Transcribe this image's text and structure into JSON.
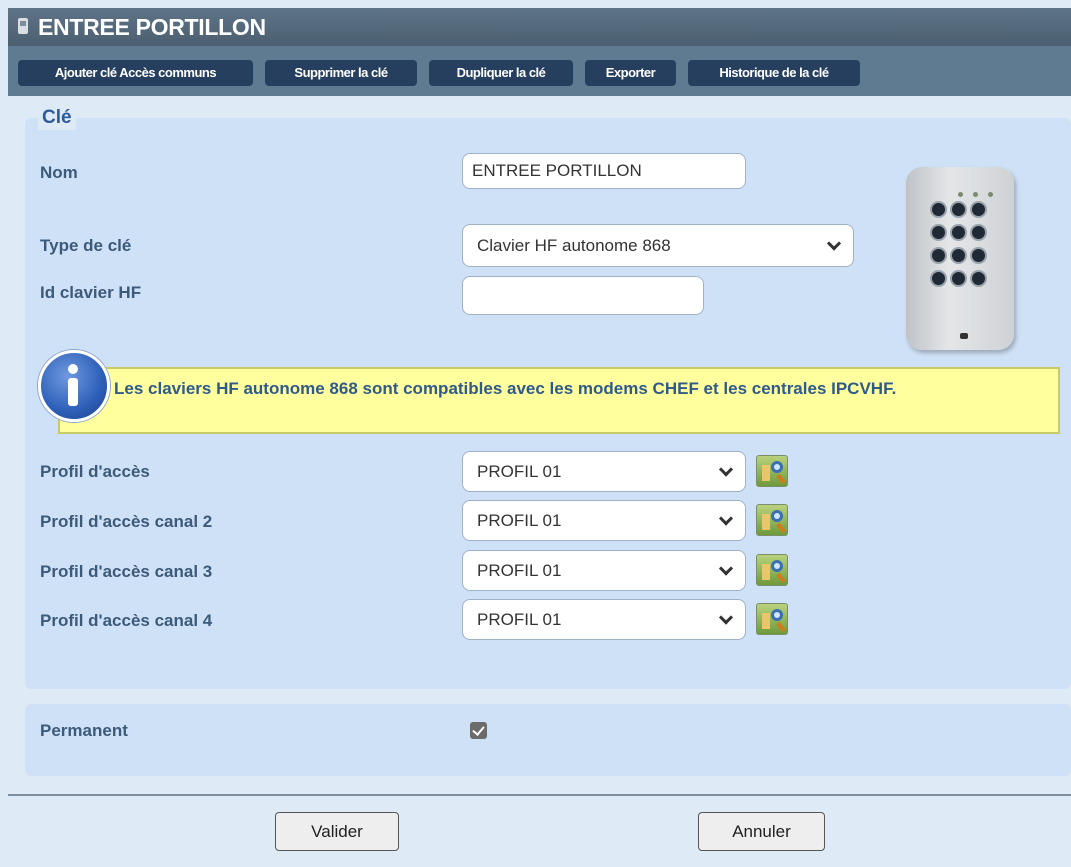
{
  "window": {
    "title": "ENTREE PORTILLON"
  },
  "toolbar": {
    "buttons": [
      "Ajouter clé Accès communs",
      "Supprimer la clé",
      "Dupliquer la clé",
      "Exporter",
      "Historique de la clé"
    ]
  },
  "key_section": {
    "legend": "Clé",
    "nom": {
      "label": "Nom",
      "value": "ENTREE PORTILLON"
    },
    "type": {
      "label": "Type de clé",
      "value": "Clavier HF autonome 868"
    },
    "id_clavier": {
      "label": "Id clavier HF",
      "value": ""
    },
    "info": "Les claviers HF autonome 868 sont compatibles avec les modems CHEF et les centrales IPCVHF.",
    "profiles": [
      {
        "label": "Profil d'accès",
        "value": "PROFIL 01"
      },
      {
        "label": "Profil d'accès canal 2",
        "value": "PROFIL 01"
      },
      {
        "label": "Profil d'accès canal 3",
        "value": "PROFIL 01"
      },
      {
        "label": "Profil d'accès canal 4",
        "value": "PROFIL 01"
      }
    ]
  },
  "permanent": {
    "label": "Permanent",
    "checked": true
  },
  "actions": {
    "validate": "Valider",
    "cancel": "Annuler"
  },
  "icons": {
    "window": "window-icon",
    "info": "info-icon",
    "profile_search": "profile-search-icon",
    "keypad": "keypad-image"
  }
}
